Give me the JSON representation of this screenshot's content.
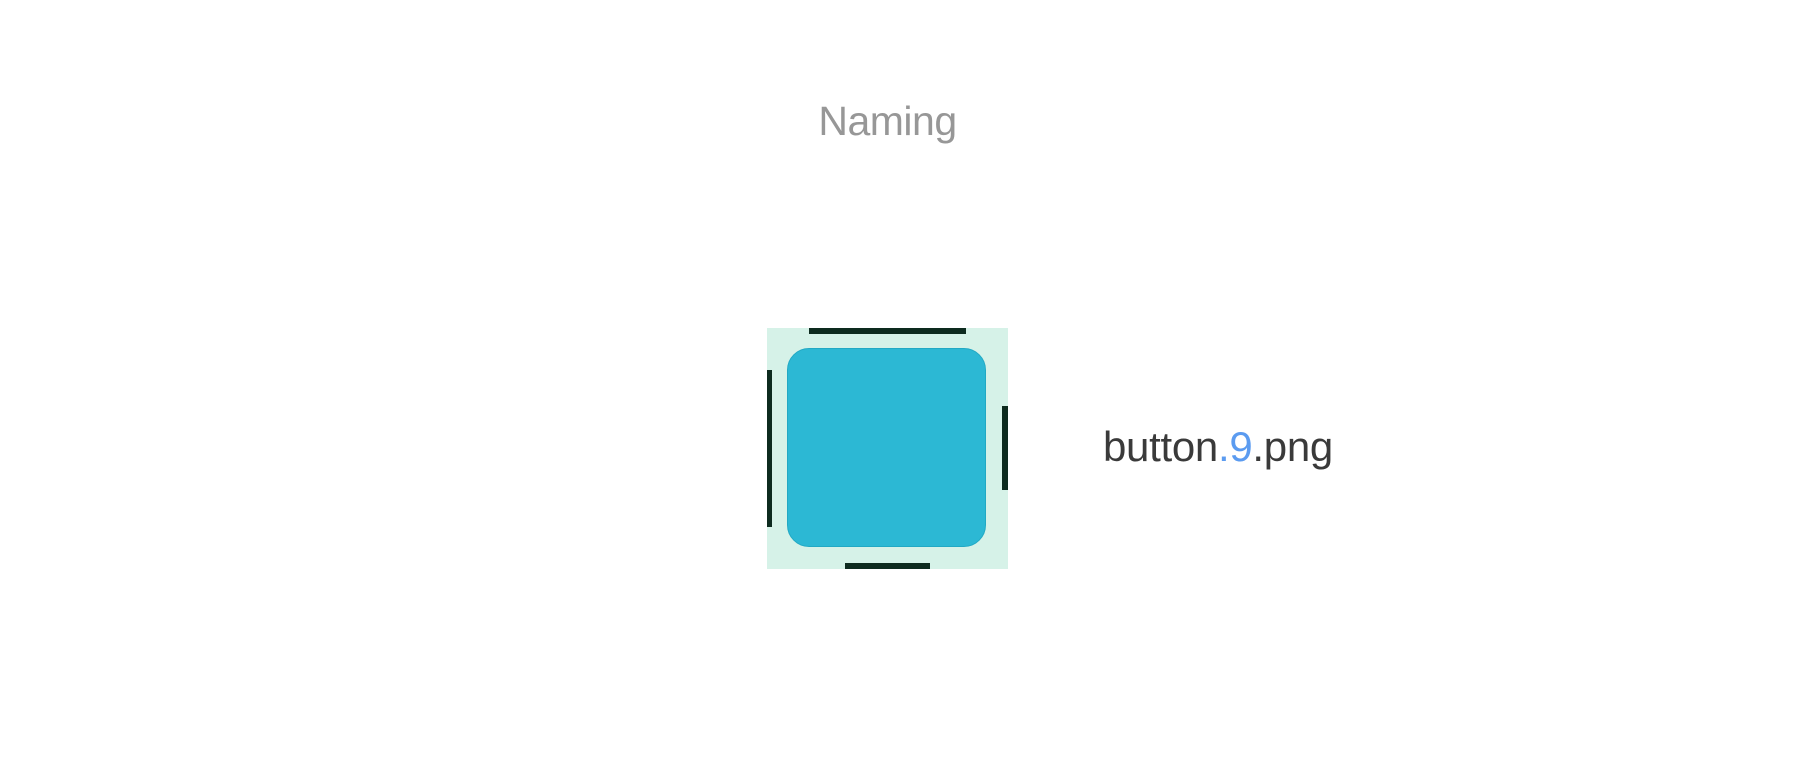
{
  "title": "Naming",
  "filename": {
    "base": "button",
    "suffix": ".9",
    "extension": ".png"
  },
  "colors": {
    "title_text": "#979797",
    "filename_text": "#3a3a3a",
    "suffix_accent": "#5b9bf0",
    "patch_background": "#d6f2e8",
    "button_fill": "#2cb8d4",
    "patch_markers": "#0d2b1f"
  }
}
